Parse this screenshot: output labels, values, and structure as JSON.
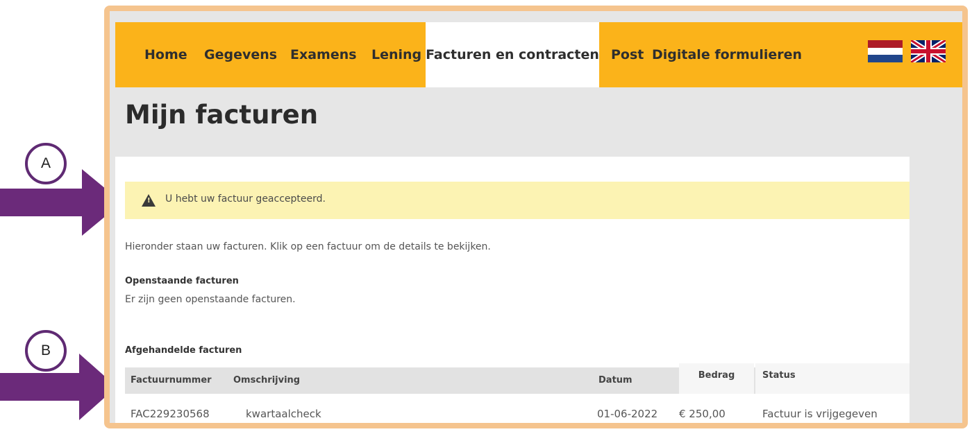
{
  "nav": {
    "items": [
      {
        "label": "Home"
      },
      {
        "label": "Gegevens"
      },
      {
        "label": "Examens"
      },
      {
        "label": "Lening"
      },
      {
        "label": "Facturen en contracten",
        "active": true
      },
      {
        "label": "Post"
      },
      {
        "label": "Digitale formulieren"
      }
    ],
    "flags": [
      "dutch-flag-icon",
      "uk-flag-icon"
    ]
  },
  "page": {
    "title": "Mijn facturen",
    "alert": "U hebt uw factuur geaccepteerd.",
    "intro": "Hieronder staan uw facturen. Klik op een factuur om de details te bekijken.",
    "open": {
      "title": "Openstaande facturen",
      "text": "Er zijn geen openstaande facturen."
    },
    "closed": {
      "title": "Afgehandelde facturen",
      "columns": [
        "Factuurnummer",
        "Omschrijving",
        "Datum",
        "Bedrag",
        "Status"
      ],
      "rows": [
        [
          "FAC229230568",
          "kwartaalcheck",
          "01-06-2022",
          "€ 250,00",
          "Factuur is vrijgegeven"
        ]
      ]
    }
  },
  "callouts": {
    "a": "A",
    "b": "B"
  },
  "colors": {
    "nav": "#fbb31a",
    "alert": "#fcf3b3",
    "arrow": "#6b2a7a",
    "frame": "#f5c48e"
  }
}
